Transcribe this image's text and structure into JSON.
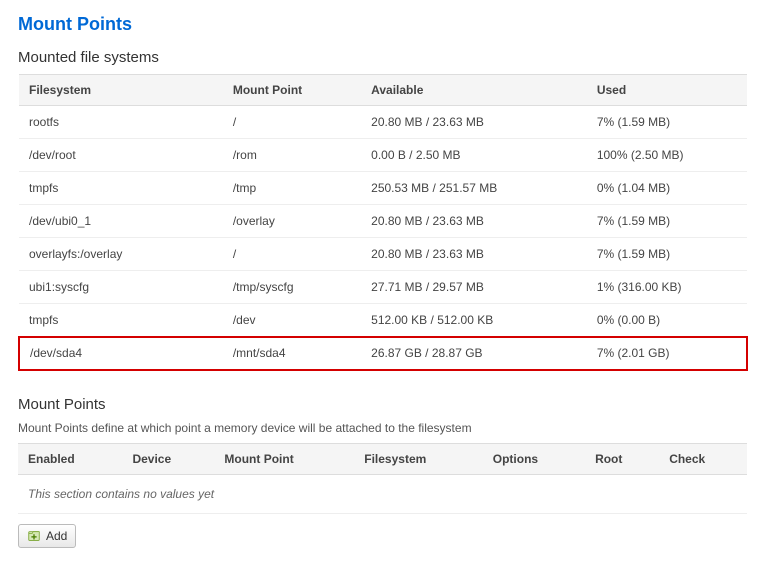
{
  "page": {
    "title": "Mount Points"
  },
  "mounted": {
    "title": "Mounted file systems",
    "headers": {
      "filesystem": "Filesystem",
      "mountpoint": "Mount Point",
      "available": "Available",
      "used": "Used"
    },
    "rows": [
      {
        "fs": "rootfs",
        "mp": "/",
        "avail": "20.80 MB / 23.63 MB",
        "used": "7% (1.59 MB)"
      },
      {
        "fs": "/dev/root",
        "mp": "/rom",
        "avail": "0.00 B / 2.50 MB",
        "used": "100% (2.50 MB)"
      },
      {
        "fs": "tmpfs",
        "mp": "/tmp",
        "avail": "250.53 MB / 251.57 MB",
        "used": "0% (1.04 MB)"
      },
      {
        "fs": "/dev/ubi0_1",
        "mp": "/overlay",
        "avail": "20.80 MB / 23.63 MB",
        "used": "7% (1.59 MB)"
      },
      {
        "fs": "overlayfs:/overlay",
        "mp": "/",
        "avail": "20.80 MB / 23.63 MB",
        "used": "7% (1.59 MB)"
      },
      {
        "fs": "ubi1:syscfg",
        "mp": "/tmp/syscfg",
        "avail": "27.71 MB / 29.57 MB",
        "used": "1% (316.00 KB)"
      },
      {
        "fs": "tmpfs",
        "mp": "/dev",
        "avail": "512.00 KB / 512.00 KB",
        "used": "0% (0.00 B)"
      },
      {
        "fs": "/dev/sda4",
        "mp": "/mnt/sda4",
        "avail": "26.87 GB / 28.87 GB",
        "used": "7% (2.01 GB)"
      }
    ]
  },
  "points": {
    "title": "Mount Points",
    "desc": "Mount Points define at which point a memory device will be attached to the filesystem",
    "headers": {
      "enabled": "Enabled",
      "device": "Device",
      "mountpoint": "Mount Point",
      "filesystem": "Filesystem",
      "options": "Options",
      "root": "Root",
      "check": "Check"
    },
    "empty": "This section contains no values yet"
  },
  "buttons": {
    "add": "Add"
  }
}
